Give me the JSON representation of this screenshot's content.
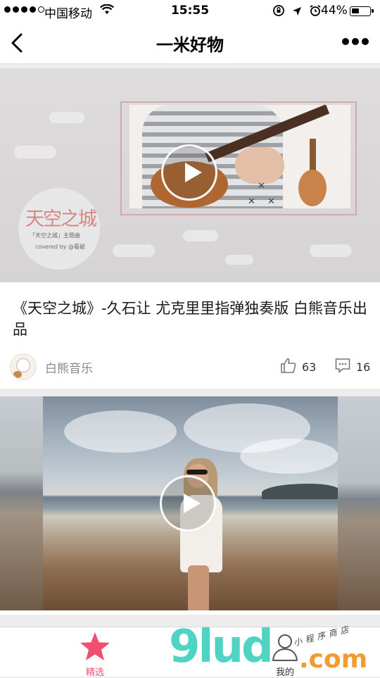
{
  "status_bar": {
    "carrier": "中国移动",
    "time": "15:55",
    "battery_percent": "44%",
    "battery_level": 0.44,
    "icons": [
      "signal-dots-icon",
      "wifi-icon",
      "rotation-lock-icon",
      "location-arrow-icon",
      "alarm-icon",
      "battery-icon"
    ]
  },
  "nav": {
    "title": "一米好物",
    "back_icon": "chevron-left-icon",
    "more_icon": "more-dots-icon"
  },
  "feed": {
    "items": [
      {
        "cover_title": "天空之城",
        "cover_subtitle": "「天空之城」主题曲",
        "cover_credit": "covered by @看破",
        "title": "《天空之城》-久石让 尤克里里指弹独奏版 白熊音乐出品",
        "author": "白熊音乐",
        "likes": "63",
        "comments": "16",
        "play_icon": "play-icon"
      },
      {
        "play_icon": "play-icon"
      }
    ]
  },
  "tabs": [
    {
      "label": "精选",
      "icon": "star-icon",
      "active": true
    },
    {
      "label": "我的",
      "icon": "user-icon",
      "active": false
    }
  ],
  "watermark": {
    "brand": "9lud",
    "suffix": ".com",
    "tag": "小程序商店"
  },
  "colors": {
    "accent": "#f0506e",
    "watermark_teal": "#4fd3c2",
    "watermark_orange": "#f39b2f"
  }
}
